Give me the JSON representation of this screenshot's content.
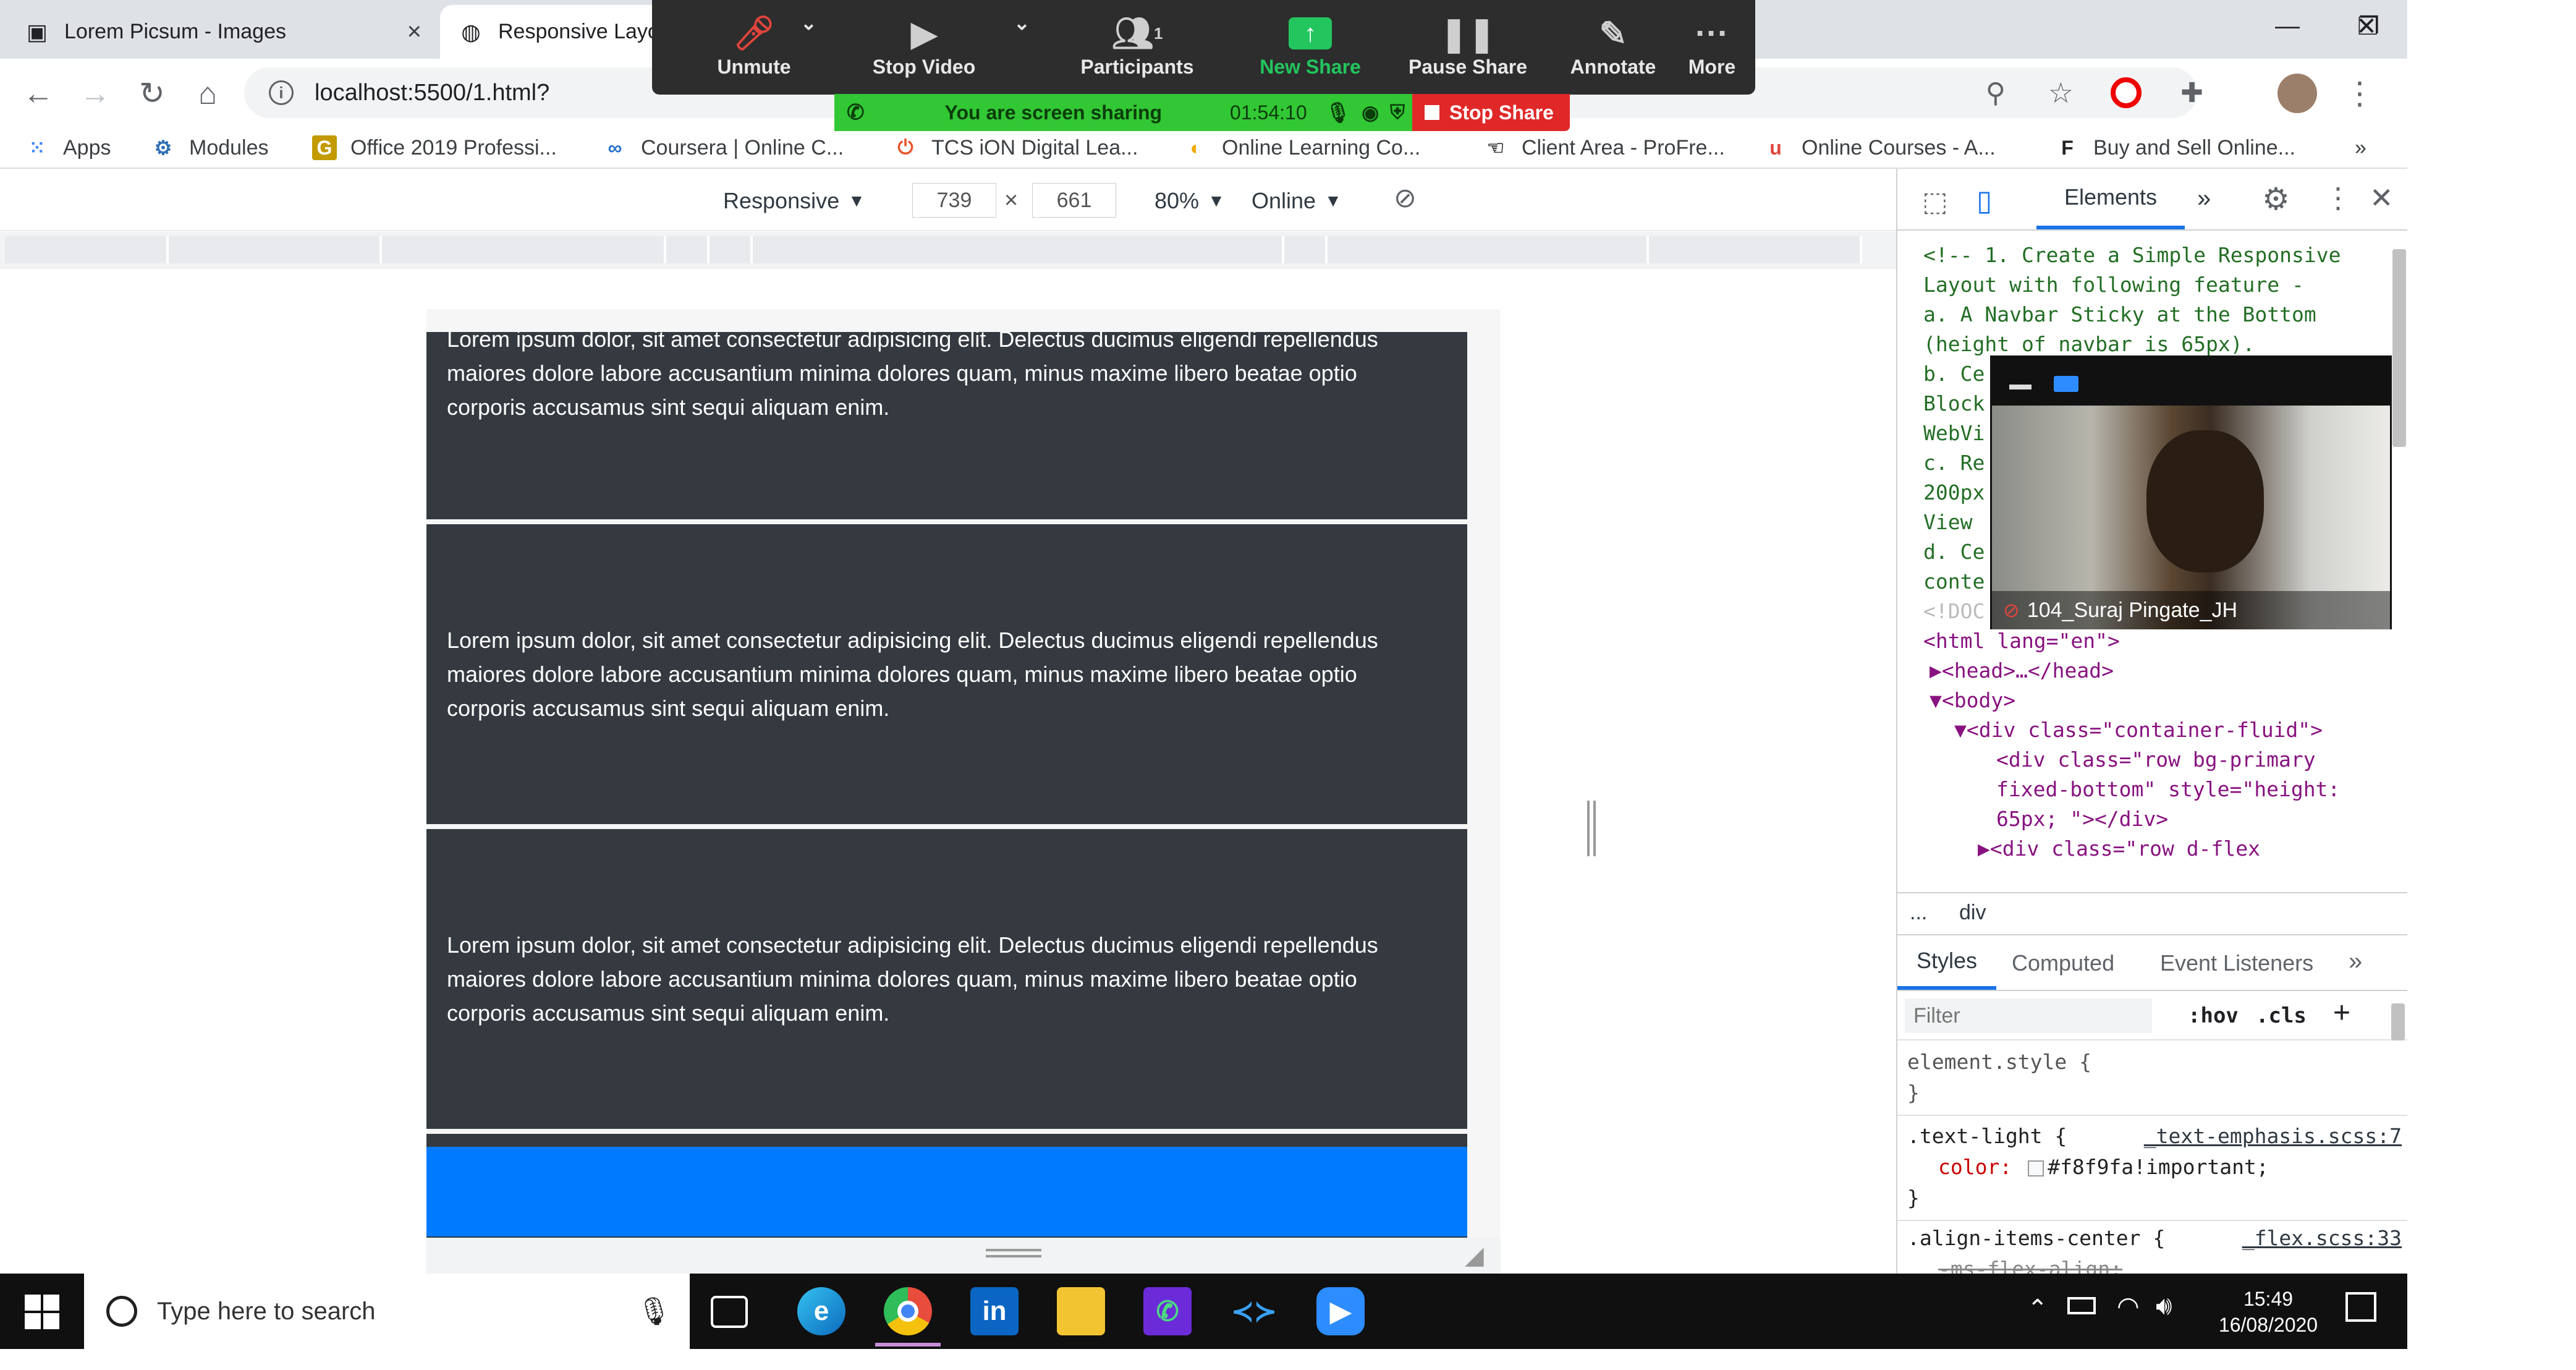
{
  "browser": {
    "tabs": [
      {
        "title": "Lorem Picsum - Images",
        "close": "×"
      },
      {
        "title": "Responsive Layo"
      }
    ],
    "window_controls": {
      "minimize": "—",
      "restore": "❐",
      "close": "✕"
    },
    "url": "localhost:5500/1.html?",
    "bookmarks": [
      {
        "label": "Apps",
        "icon": "apps-grid-icon"
      },
      {
        "label": "Modules",
        "icon": "modules-icon"
      },
      {
        "label": "Office 2019 Professi...",
        "icon": "office-icon"
      },
      {
        "label": "Coursera | Online C...",
        "icon": "coursera-icon"
      },
      {
        "label": "TCS iON Digital Lea...",
        "icon": "tcs-icon"
      },
      {
        "label": "Online Learning Co...",
        "icon": "online-learning-icon"
      },
      {
        "label": "Client Area - ProFre...",
        "icon": "profreehost-icon"
      },
      {
        "label": "Online Courses - A...",
        "icon": "udemy-icon"
      },
      {
        "label": "Buy and Sell Online...",
        "icon": "buysell-icon"
      }
    ],
    "bookmarks_more": "»"
  },
  "zoom": {
    "controls": [
      {
        "label": "Unmute",
        "icon": "mic-muted-icon"
      },
      {
        "label": "Stop Video",
        "icon": "video-camera-icon"
      },
      {
        "label": "Participants",
        "icon": "participants-icon",
        "count": "1"
      },
      {
        "label": "New Share",
        "icon": "share-screen-icon"
      },
      {
        "label": "Pause Share",
        "icon": "pause-icon"
      },
      {
        "label": "Annotate",
        "icon": "pen-icon"
      },
      {
        "label": "More",
        "icon": "more-dots-icon"
      }
    ],
    "sharing_text": "You are screen sharing",
    "timer": "01:54:10",
    "stop_share": "Stop Share",
    "video_name": "104_Suraj Pingate_JH"
  },
  "device_toolbar": {
    "mode": "Responsive",
    "width": "739",
    "times": "×",
    "height": "661",
    "zoom": "80%",
    "network": "Online"
  },
  "page": {
    "card_text": "Lorem ipsum dolor, sit amet consectetur adipisicing elit. Delectus ducimus eligendi repellendus maiores dolore labore accusantium minima dolores quam, minus maxime libero beatae optio corporis accusamus sint sequi aliquam enim."
  },
  "devtools": {
    "tabs": {
      "active": "Elements",
      "more": "»"
    },
    "comment_lines": [
      "<!-- 1. Create a Simple Responsive",
      "Layout with following feature -",
      "a. A Navbar Sticky at the Bottom",
      "(height of navbar is 65px).",
      "b. Ce",
      "Block",
      "WebVi",
      "c. Re",
      "200px",
      "View",
      "d. Ce",
      "conte",
      "<!DOC"
    ],
    "html_lines": [
      "<html lang=\"en\">",
      "▶<head>…</head>",
      "▼<body>",
      "▼<div class=\"container-fluid\">",
      "<div class=\"row bg-primary",
      "fixed-bottom\" style=\"height:",
      "65px; \"></div>",
      "▶<div class=\"row d-flex"
    ],
    "breadcrumb": [
      "...",
      "div"
    ],
    "style_tabs": [
      "Styles",
      "Computed",
      "Event Listeners",
      "»"
    ],
    "filter_placeholder": "Filter",
    "hov": ":hov",
    "cls": ".cls",
    "plus": "+",
    "rules": [
      {
        "selector": "element.style {",
        "close": "}"
      },
      {
        "selector": ".text-light {",
        "source": "_text-emphasis.scss:7",
        "prop": "color:",
        "value": "#f8f9fa!important;",
        "close": "}"
      },
      {
        "selector": ".align-items-center {",
        "source": "_flex.scss:33",
        "prop": "-ms-flex-align:"
      }
    ]
  },
  "taskbar": {
    "search_placeholder": "Type here to search",
    "time": "15:49",
    "date": "16/08/2020",
    "apps": [
      "task-view-icon",
      "edge-icon",
      "chrome-icon",
      "linkedin-icon",
      "file-explorer-icon",
      "whatsapp-icon",
      "vscode-icon",
      "zoom-icon"
    ]
  },
  "colors": {
    "card_bg": "#343a40",
    "primary": "#007bff",
    "zoom_green": "#32c734",
    "zoom_red": "#e02828",
    "taskbar": "#101010"
  }
}
